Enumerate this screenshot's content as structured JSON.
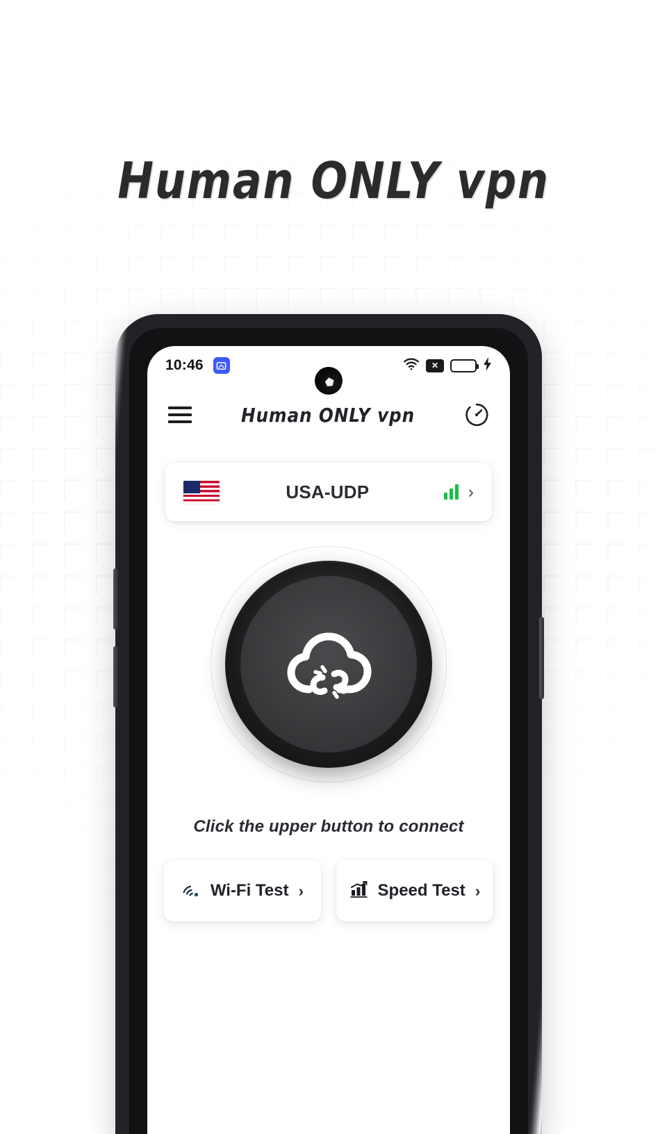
{
  "page": {
    "headline": "Human ONLY vpn"
  },
  "phone": {
    "status_bar": {
      "time": "10:46",
      "app_icon": "app-notification-icon",
      "camera": "front-camera-punch-hole",
      "wifi_icon": "wifi-icon",
      "no_sim_label": "✕",
      "battery_icon": "battery-icon",
      "charging_icon": "⚡"
    },
    "hardware": {
      "volume_up": "volume-up-button",
      "volume_down": "volume-down-button",
      "power": "power-button"
    }
  },
  "app": {
    "header": {
      "menu_icon": "hamburger-menu-icon",
      "title": "Human ONLY vpn",
      "speed_icon": "speedometer-icon"
    },
    "server": {
      "flag": "us-flag",
      "name": "USA-UDP",
      "signal_bars": 3,
      "signal_color": "#15c144",
      "chevron": "›"
    },
    "connect": {
      "icon": "cloud-disconnected-icon",
      "state": "disconnected",
      "hint": "Click the upper button to connect"
    },
    "tools": [
      {
        "icon": "wifi-test-icon",
        "label": "Wi-Fi Test",
        "chevron": "›"
      },
      {
        "icon": "speed-chart-icon",
        "label": "Speed Test",
        "chevron": "›"
      }
    ]
  },
  "colors": {
    "accent_green": "#15c144",
    "accent_blue": "#3d5afe",
    "text_dark": "#22222a",
    "button_dark": "#1b1b1d"
  }
}
